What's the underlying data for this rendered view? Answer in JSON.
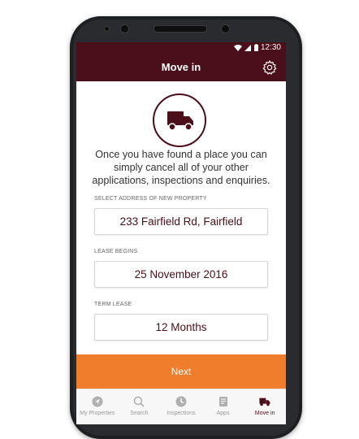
{
  "status_bar": {
    "time": "12:30"
  },
  "app_bar": {
    "title": "Move in",
    "settings_icon": "gear-icon"
  },
  "hero": {
    "icon": "truck-icon",
    "message": "Once you have found a place you can simply cancel all of your other applications, inspections and enquiries."
  },
  "form": {
    "address": {
      "label": "SELECT ADDRESS OF NEW PROPERTY",
      "value": "233 Fairfield Rd, Fairfield"
    },
    "lease_begins": {
      "label": "LEASE BEGINS",
      "value": "25 November 2016"
    },
    "term_lease": {
      "label": "TERM LEASE",
      "value": "12 Months"
    }
  },
  "next_button": {
    "label": "Next",
    "color": "#ef7d2c"
  },
  "tabs": [
    {
      "label": "My Properties",
      "icon": "navigation-icon"
    },
    {
      "label": "Search",
      "icon": "search-icon"
    },
    {
      "label": "Inspections",
      "icon": "clock-icon"
    },
    {
      "label": "Apps",
      "icon": "document-icon"
    },
    {
      "label": "Move in",
      "icon": "truck-icon",
      "active": true
    }
  ],
  "colors": {
    "brand": "#4a0f1a",
    "accent": "#ef7d2c"
  }
}
